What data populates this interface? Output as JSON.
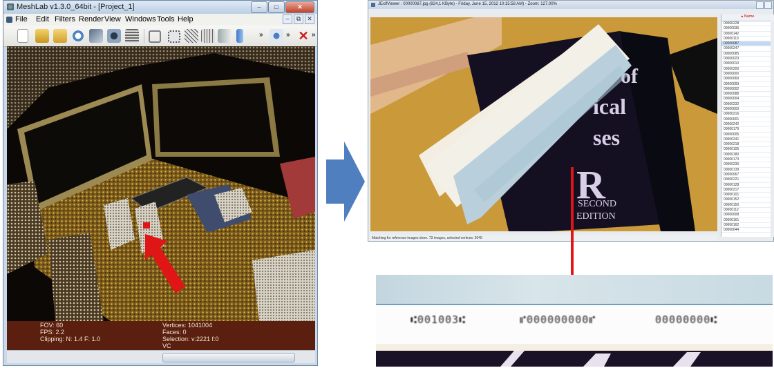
{
  "meshlab": {
    "title": "MeshLab v1.3.0_64bit - [Project_1]",
    "menu": [
      "File",
      "Edit",
      "Filters",
      "Render",
      "View",
      "Windows",
      "Tools",
      "Help"
    ],
    "status": {
      "fov": "FOV: 60",
      "fps": "FPS:    2.2",
      "clipping": "Clipping: N:    1.4 F:    1.0",
      "vertices": "Vertices: 1041004",
      "faces": "Faces: 0",
      "selection": "Selection: v:2221 f:0",
      "vc": "VC"
    }
  },
  "jexif": {
    "title": "JExifViewer : 00000087.jpg  (824,1 KByte)  -  Friday, June 15, 2012  10:15:58 AM)  -  Zoom: 127.00%",
    "status": "Matching for reference images done. 73 images, selected vertices: 3040",
    "list_header": "▴ Name",
    "list_items": [
      "00000228",
      "00000036",
      "00000142",
      "00000113",
      "00000087",
      "00000247",
      "00000085",
      "00000023",
      "00000010",
      "00000200",
      "00000000",
      "00000069",
      "00000093",
      "00000002",
      "00000088",
      "00000004",
      "00000232",
      "00000003",
      "00000216",
      "00000001",
      "00000242",
      "00000179",
      "00000005",
      "00000241",
      "00000218",
      "00000105",
      "00000180",
      "00000173",
      "00000230",
      "00000139",
      "00000067",
      "00000221",
      "00000128",
      "00000217",
      "00000101",
      "00000152",
      "00000150",
      "00000112",
      "00000008",
      "00000161",
      "00000162",
      "00000044"
    ],
    "selected_index": 4
  },
  "photo": {
    "book_text": [
      "of",
      "ical",
      "ses",
      "R",
      "SECOND",
      "EDITION"
    ]
  },
  "zoom": {
    "micr": [
      "⑆001003⑆",
      "⑈000000000⑈",
      "00000000⑆"
    ]
  },
  "colors": {
    "flow_arrow": "#4f7fbf",
    "highlight_arrow": "#e01515"
  }
}
